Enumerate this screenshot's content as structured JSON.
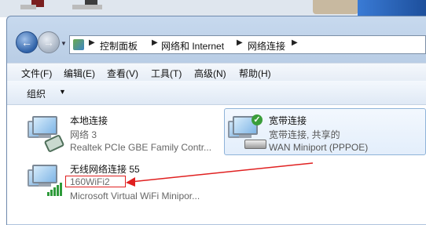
{
  "address_bar": {
    "crumbs": [
      "控制面板",
      "网络和 Internet",
      "网络连接"
    ]
  },
  "menu": [
    "文件(F)",
    "编辑(E)",
    "查看(V)",
    "工具(T)",
    "高级(N)",
    "帮助(H)"
  ],
  "command_bar": {
    "organize_label": "组织"
  },
  "connections": [
    {
      "name": "本地连接",
      "status": "网络  3",
      "device": "Realtek PCIe GBE Family Contr..."
    },
    {
      "name": "宽带连接",
      "status": "宽带连接, 共享的",
      "device": "WAN Miniport (PPPOE)"
    },
    {
      "name": "无线网络连接 55",
      "status": "160WiFi2",
      "device": "Microsoft Virtual WiFi Minipor..."
    }
  ],
  "colors": {
    "annotation": "#e02020",
    "ok_badge": "#3a9d3a",
    "signal": "#2e9a3a"
  }
}
